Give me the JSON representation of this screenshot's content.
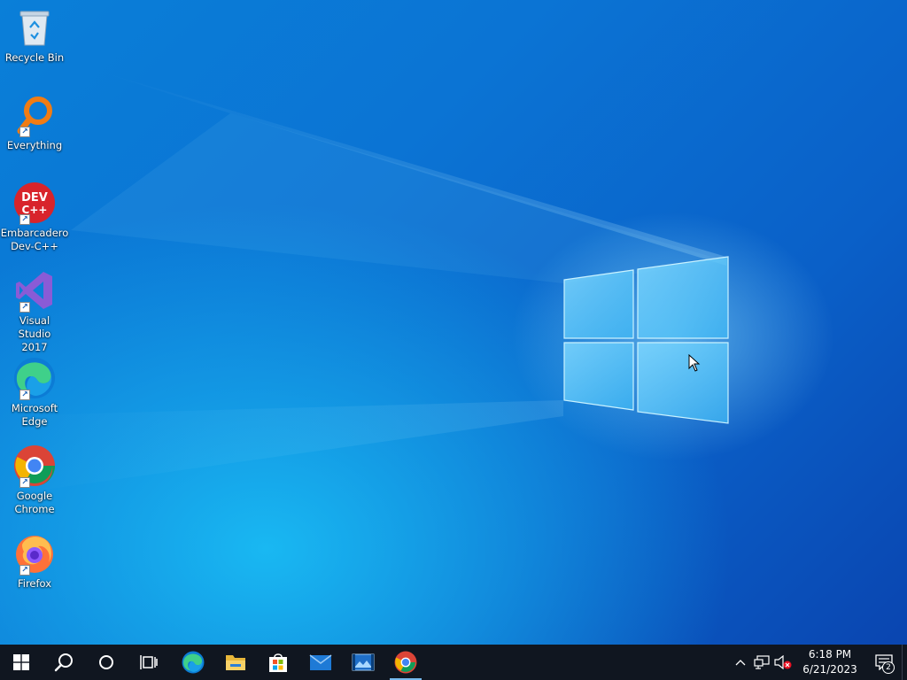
{
  "desktop": {
    "icons": [
      {
        "label": "Recycle Bin",
        "icon": "recycle-bin-icon"
      },
      {
        "label": "Everything",
        "icon": "everything-search-icon"
      },
      {
        "label": "Embarcadero\nDev-C++",
        "icon": "dev-cpp-icon"
      },
      {
        "label": "Visual Studio\n2017",
        "icon": "visual-studio-icon"
      },
      {
        "label": "Microsoft\nEdge",
        "icon": "edge-icon"
      },
      {
        "label": "Google\nChrome",
        "icon": "chrome-icon"
      },
      {
        "label": "Firefox",
        "icon": "firefox-icon"
      }
    ],
    "devcpp_badge": {
      "line1": "DEV",
      "line2": "C++"
    }
  },
  "taskbar": {
    "pinned": [
      "start-icon",
      "search-icon",
      "cortana-icon",
      "task-view-icon",
      "edge-icon",
      "file-explorer-icon",
      "store-icon",
      "mail-icon",
      "photos-icon",
      "chrome-icon"
    ],
    "tray_icons": [
      "chevron-up-icon",
      "network-icon",
      "volume-muted-icon"
    ],
    "clock": {
      "time": "6:18 PM",
      "date": "6/21/2023"
    },
    "notification_count": "2"
  },
  "colors": {
    "taskbar": "#101620",
    "accent": "#76b9ed",
    "wallpaper_blue": "#0a74d4"
  }
}
